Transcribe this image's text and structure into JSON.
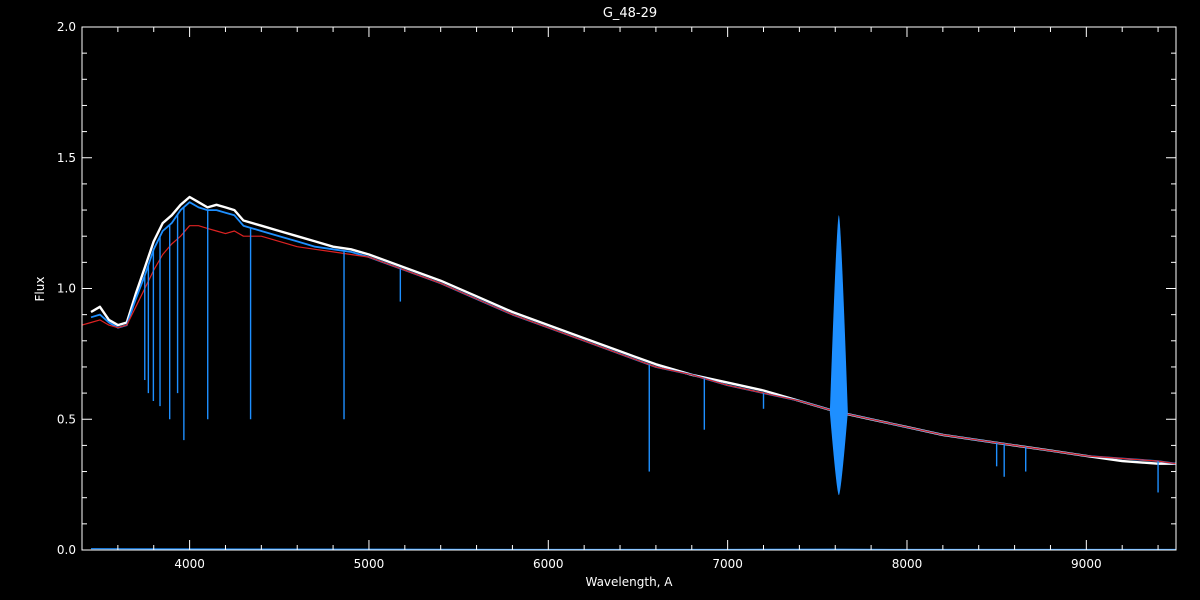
{
  "chart_data": {
    "type": "line",
    "title": "G_48-29",
    "xlabel": "Wavelength, A",
    "ylabel": "Flux",
    "xlim": [
      3400,
      9500
    ],
    "ylim": [
      0,
      2.0
    ],
    "x_ticks": [
      4000,
      5000,
      6000,
      7000,
      8000,
      9000
    ],
    "x_tick_labels": [
      "4000",
      "5000",
      "6000",
      "7000",
      "8000",
      "9000"
    ],
    "y_ticks": [
      0,
      0.5,
      1.0,
      1.5,
      2.0
    ],
    "y_tick_labels": [
      "0.0",
      "0.5",
      "1.0",
      "1.5",
      "2.0"
    ],
    "grid": false,
    "colors": {
      "background": "#000000",
      "axes": "#ffffff",
      "observed": "#ffffff",
      "model": "#1e8fff",
      "fit": "#dd2222",
      "error": "#1e8fff"
    },
    "series": [
      {
        "color_key": "observed",
        "x": [
          3450,
          3500,
          3550,
          3600,
          3650,
          3700,
          3750,
          3800,
          3850,
          3900,
          3950,
          4000,
          4050,
          4100,
          4150,
          4200,
          4250,
          4300,
          4400,
          4500,
          4600,
          4700,
          4800,
          4900,
          5000,
          5200,
          5400,
          5600,
          5800,
          6000,
          6200,
          6400,
          6600,
          6800,
          7000,
          7200,
          7400,
          7600,
          7800,
          8000,
          8200,
          8400,
          8600,
          8800,
          9000,
          9200,
          9400,
          9500
        ],
        "y": [
          0.91,
          0.93,
          0.88,
          0.86,
          0.87,
          0.98,
          1.08,
          1.18,
          1.25,
          1.28,
          1.32,
          1.35,
          1.33,
          1.31,
          1.32,
          1.31,
          1.3,
          1.26,
          1.24,
          1.22,
          1.2,
          1.18,
          1.16,
          1.15,
          1.13,
          1.08,
          1.03,
          0.97,
          0.91,
          0.86,
          0.81,
          0.76,
          0.71,
          0.67,
          0.64,
          0.61,
          0.57,
          0.53,
          0.5,
          0.47,
          0.44,
          0.42,
          0.4,
          0.38,
          0.36,
          0.34,
          0.33,
          0.33
        ]
      },
      {
        "color_key": "model",
        "x": [
          3450,
          3500,
          3550,
          3600,
          3650,
          3700,
          3750,
          3800,
          3850,
          3900,
          3950,
          4000,
          4050,
          4100,
          4150,
          4200,
          4250,
          4300,
          4400,
          4500,
          4600,
          4700,
          4800,
          4900,
          5000,
          5200,
          5400,
          5600,
          5800,
          6000,
          6200,
          6400,
          6600,
          6800,
          7000,
          7200,
          7400,
          7600,
          7800,
          8000,
          8200,
          8400,
          8600,
          8800,
          9000,
          9200,
          9400,
          9500
        ],
        "y": [
          0.89,
          0.9,
          0.87,
          0.85,
          0.86,
          0.96,
          1.05,
          1.15,
          1.22,
          1.25,
          1.3,
          1.33,
          1.31,
          1.3,
          1.3,
          1.29,
          1.28,
          1.24,
          1.22,
          1.2,
          1.18,
          1.16,
          1.15,
          1.14,
          1.12,
          1.07,
          1.02,
          0.96,
          0.9,
          0.85,
          0.8,
          0.75,
          0.7,
          0.67,
          0.63,
          0.6,
          0.57,
          0.53,
          0.5,
          0.47,
          0.44,
          0.42,
          0.4,
          0.38,
          0.36,
          0.35,
          0.34,
          0.33
        ]
      },
      {
        "color_key": "fit",
        "x": [
          3400,
          3450,
          3500,
          3550,
          3600,
          3650,
          3700,
          3750,
          3800,
          3850,
          3900,
          3950,
          4000,
          4050,
          4100,
          4150,
          4200,
          4250,
          4300,
          4400,
          4500,
          4600,
          4700,
          4800,
          4900,
          5000,
          5200,
          5400,
          5600,
          5800,
          6000,
          6200,
          6400,
          6600,
          6800,
          7000,
          7200,
          7400,
          7600,
          7800,
          8000,
          8200,
          8400,
          8600,
          8800,
          9000,
          9200,
          9400,
          9500
        ],
        "y": [
          0.86,
          0.87,
          0.88,
          0.86,
          0.85,
          0.86,
          0.93,
          1.0,
          1.07,
          1.13,
          1.17,
          1.2,
          1.24,
          1.24,
          1.23,
          1.22,
          1.21,
          1.22,
          1.2,
          1.2,
          1.18,
          1.16,
          1.15,
          1.14,
          1.13,
          1.12,
          1.07,
          1.02,
          0.96,
          0.9,
          0.85,
          0.8,
          0.75,
          0.7,
          0.67,
          0.63,
          0.6,
          0.57,
          0.53,
          0.5,
          0.47,
          0.44,
          0.42,
          0.4,
          0.38,
          0.36,
          0.35,
          0.34,
          0.33
        ]
      },
      {
        "color_key": "error",
        "x": [
          3450,
          4000,
          5000,
          6000,
          7000,
          7600,
          8000,
          9000,
          9500
        ],
        "y": [
          0.005,
          0.004,
          0.003,
          0.002,
          0.002,
          0.003,
          0.002,
          0.002,
          0.002
        ]
      }
    ],
    "absorption_lines": [
      {
        "x": 3750,
        "y": 0.65
      },
      {
        "x": 3770,
        "y": 0.6
      },
      {
        "x": 3798,
        "y": 0.57
      },
      {
        "x": 3835,
        "y": 0.55
      },
      {
        "x": 3889,
        "y": 0.5
      },
      {
        "x": 3933,
        "y": 0.6
      },
      {
        "x": 3968,
        "y": 0.42
      },
      {
        "x": 4101,
        "y": 0.5
      },
      {
        "x": 4340,
        "y": 0.5
      },
      {
        "x": 4861,
        "y": 0.5
      },
      {
        "x": 5175,
        "y": 0.95
      },
      {
        "x": 6563,
        "y": 0.3
      },
      {
        "x": 6870,
        "y": 0.46
      },
      {
        "x": 7200,
        "y": 0.54
      },
      {
        "x": 8500,
        "y": 0.32
      },
      {
        "x": 8542,
        "y": 0.28
      },
      {
        "x": 8662,
        "y": 0.3
      },
      {
        "x": 9400,
        "y": 0.22
      }
    ],
    "telluric_feature": {
      "x": 7620,
      "y_top": 1.28,
      "y_bottom": 0.21
    }
  }
}
